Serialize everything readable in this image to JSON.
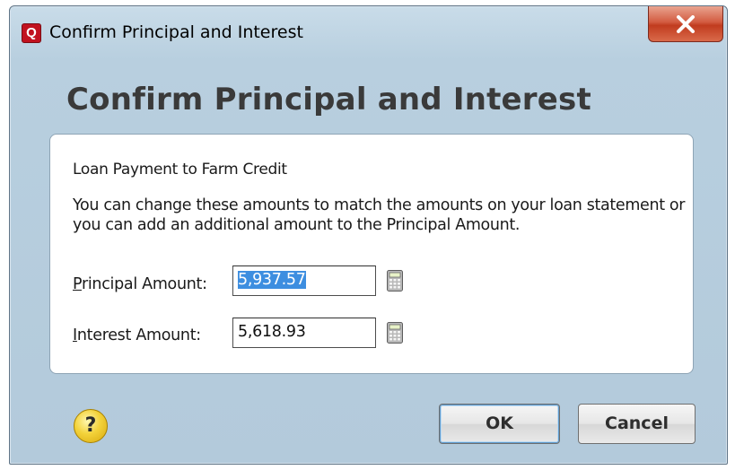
{
  "window": {
    "title": "Confirm Principal and Interest",
    "app_icon_letter": "Q"
  },
  "dialog": {
    "heading": "Confirm Principal and Interest",
    "subtitle": "Loan Payment to Farm Credit",
    "description": "You can change these amounts to match the amounts on your loan statement or you can add an additional amount to the Principal Amount.",
    "fields": [
      {
        "label_underlined": "P",
        "label_rest": "rincipal Amount:",
        "value": "5,937.57",
        "selected": true
      },
      {
        "label_underlined": "I",
        "label_rest": "nterest Amount:",
        "value": "5,618.93",
        "selected": false
      }
    ]
  },
  "buttons": {
    "help": "?",
    "ok": "OK",
    "cancel": "Cancel"
  },
  "colors": {
    "window_bg": "#b8cfdf",
    "close_button": "#c13c1f",
    "selection": "#3d8ee0",
    "help_icon": "#f3d23a",
    "app_icon": "#c1121f"
  }
}
